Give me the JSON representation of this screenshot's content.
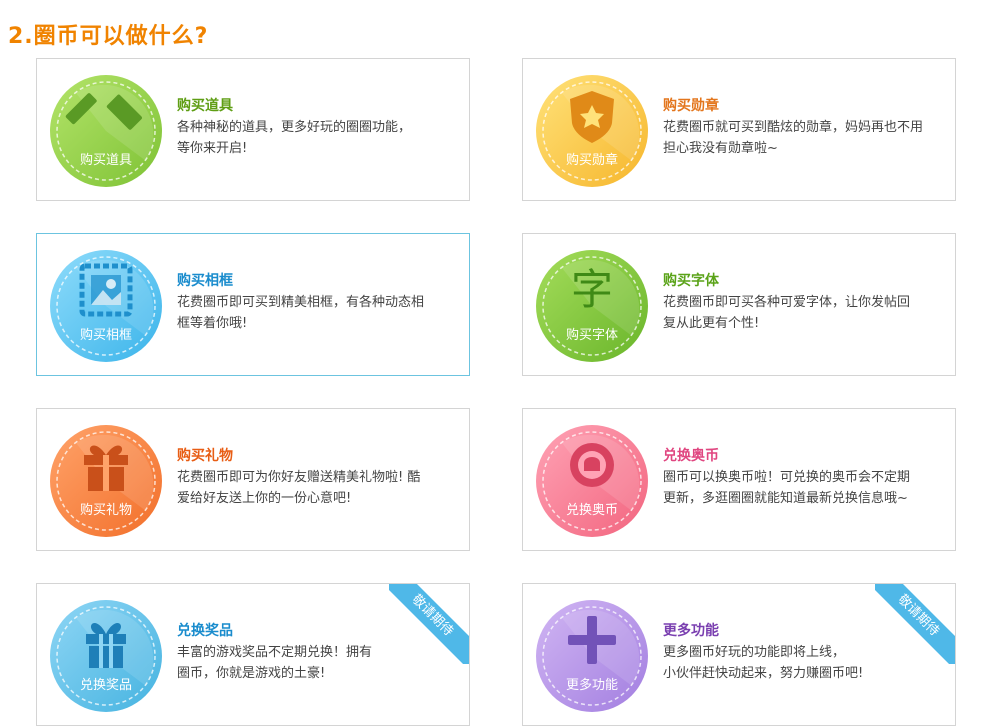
{
  "heading": "2.圈币可以做什么?",
  "cards": [
    {
      "title": "购买道具",
      "title_color": "#5f9e14",
      "desc_line1": "各种神秘的道具，更多好玩的圈圈功能，",
      "desc_line2": "等你来开启!",
      "coin_label": "购买道具",
      "icon": "hammer-icon",
      "color_light": "#b4e46a",
      "color_dark": "#7ec235",
      "icon_color": "#5a9a25",
      "ribbon": ""
    },
    {
      "title": "购买勋章",
      "title_color": "#e3761d",
      "desc_line1": "花费圈币就可买到酷炫的勋章，妈妈再也不用",
      "desc_line2": "担心我没有勋章啦~",
      "coin_label": "购买勋章",
      "icon": "medal-icon",
      "color_light": "#ffe27a",
      "color_dark": "#f6b62c",
      "icon_color": "#e08a18",
      "ribbon": ""
    },
    {
      "title": "购买相框",
      "title_color": "#1a8ccd",
      "desc_line1": "花费圈币即可买到精美相框，有各种动态相",
      "desc_line2": "框等着你哦!",
      "coin_label": "购买相框",
      "icon": "picture-frame-icon",
      "color_light": "#8fdcfb",
      "color_dark": "#3bb4ea",
      "icon_color": "#1e8fcc",
      "ribbon": ""
    },
    {
      "title": "购买字体",
      "title_color": "#5aa318",
      "desc_line1": "花费圈币即可买各种可爱字体，让你发帖回",
      "desc_line2": "复从此更有个性!",
      "coin_label": "购买字体",
      "icon": "font-icon",
      "color_light": "#a5dd5b",
      "color_dark": "#69b52a",
      "icon_color": "#3f8a16",
      "ribbon": ""
    },
    {
      "title": "购买礼物",
      "title_color": "#e85d14",
      "desc_line1": "花费圈币即可为你好友赠送精美礼物啦! 酷",
      "desc_line2": "爱给好友送上你的一份心意吧!",
      "coin_label": "购买礼物",
      "icon": "gift-box-icon",
      "color_light": "#ffa36a",
      "color_dark": "#f26f2a",
      "icon_color": "#c9501a",
      "ribbon": ""
    },
    {
      "title": "兑换奥币",
      "title_color": "#e04680",
      "desc_line1": "圈币可以换奥币啦！可兑换的奥币会不定期",
      "desc_line2": "更新，多逛圈圈就能知道最新兑换信息哦~",
      "coin_label": "兑换奥币",
      "icon": "coin-icon",
      "color_light": "#ffa3b5",
      "color_dark": "#f2657f",
      "icon_color": "#d84260",
      "ribbon": ""
    },
    {
      "title": "兑换奖品",
      "title_color": "#1a8ccd",
      "desc_line1": "丰富的游戏奖品不定期兑换！拥有",
      "desc_line2": "圈币，你就是游戏的土豪!",
      "coin_label": "兑换奖品",
      "icon": "prize-gift-icon",
      "color_light": "#8fd6f5",
      "color_dark": "#45b3e0",
      "icon_color": "#1e7fb8",
      "ribbon": "敬请期待"
    },
    {
      "title": "更多功能",
      "title_color": "#7a3fb0",
      "desc_line1": "更多圈币好玩的功能即将上线，",
      "desc_line2": "小伙伴赶快动起来，努力赚圈币吧!",
      "coin_label": "更多功能",
      "icon": "plus-icon",
      "color_light": "#d1b6f3",
      "color_dark": "#a27ee0",
      "icon_color": "#7252b8",
      "ribbon": "敬请期待"
    }
  ]
}
